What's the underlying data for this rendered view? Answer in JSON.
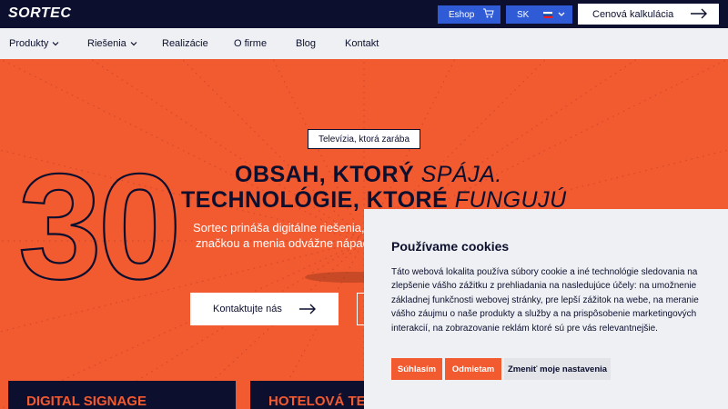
{
  "header": {
    "logo": "SORTEC",
    "eshop_label": "Eshop",
    "eshop_icon": "cart-icon",
    "lang_label": "SK",
    "calc_label": "Cenová kalkulácia"
  },
  "nav": {
    "items": [
      {
        "label": "Produkty",
        "has_dropdown": true
      },
      {
        "label": "Riešenia",
        "has_dropdown": true
      },
      {
        "label": "Realizácie",
        "has_dropdown": false
      },
      {
        "label": "O firme",
        "has_dropdown": false
      },
      {
        "label": "Blog",
        "has_dropdown": false
      },
      {
        "label": "Kontakt",
        "has_dropdown": false
      }
    ]
  },
  "hero": {
    "big_number": "30",
    "badge": "Televízia, ktorá zarába",
    "line1_bold": "OBSAH, KTORÝ ",
    "line1_italic": "SPÁJA.",
    "line2_bold": "TECHNOLÓGIE, KTORÉ ",
    "line2_italic": "FUNGUJÚ",
    "desc_line1": "Sortec prináša digitálne riešenia,",
    "desc_line2": "značkou a menia odvážne nápad",
    "contact_button": "Kontaktujte nás"
  },
  "cards": [
    {
      "label": "DIGITAL SIGNAGE"
    },
    {
      "label": "HOTELOVÁ TEL"
    }
  ],
  "cookie": {
    "title": "Používame cookies",
    "text": "Táto webová lokalita používa súbory cookie a iné technológie sledovania na zlepšenie vášho zážitku z prehliadania na nasledujúce účely: na umožnenie základnej funkčnosti webovej stránky, pre lepší zážitok na webe, na meranie vášho záujmu o naše produkty a služby a na prispôsobenie marketingových interakcií, na zobrazovanie reklám ktoré sú pre vás relevantnejšie.",
    "accept_label": "Súhlasím",
    "reject_label": "Odmietam",
    "settings_label": "Zmeniť moje nastavenia"
  },
  "colors": {
    "brand_orange": "#f25a30",
    "navy": "#0c0f2e",
    "accent_blue": "#2f5bd6",
    "panel_gray": "#eef0f3"
  }
}
